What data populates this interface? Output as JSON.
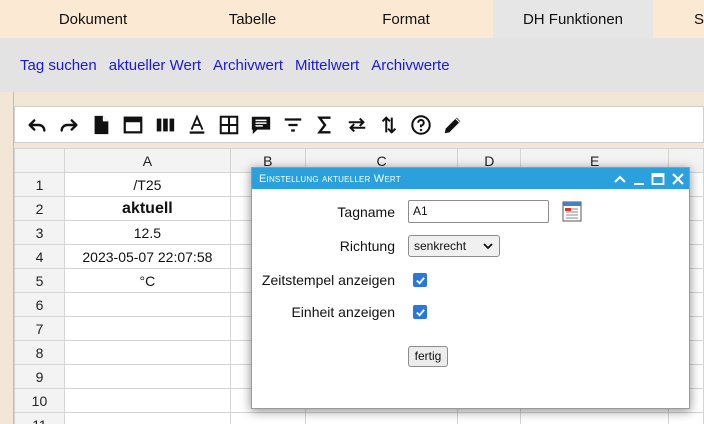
{
  "tabs": [
    {
      "label": "Dokument",
      "active": false
    },
    {
      "label": "Tabelle",
      "active": false
    },
    {
      "label": "Format",
      "active": false
    },
    {
      "label": "DH Funktionen",
      "active": true
    },
    {
      "label": "S",
      "active": false
    }
  ],
  "links": [
    "Tag suchen",
    "aktueller Wert",
    "Archivwert",
    "Mittelwert",
    "Archivwerte"
  ],
  "toolbar_icons": [
    "undo-icon",
    "redo-icon",
    "document-icon",
    "window-icon",
    "columns-icon",
    "text-color-icon",
    "borders-icon",
    "comment-icon",
    "filter-icon",
    "sum-icon",
    "swap-horizontal-icon",
    "sort-vertical-icon",
    "help-icon",
    "edit-pencil-icon"
  ],
  "sheet": {
    "columns": [
      "A",
      "B",
      "C",
      "D",
      "E"
    ],
    "rows": [
      {
        "n": "1",
        "a": "/T25"
      },
      {
        "n": "2",
        "a": "aktuell"
      },
      {
        "n": "3",
        "a": "12.5"
      },
      {
        "n": "4",
        "a": "2023-05-07 22:07:58"
      },
      {
        "n": "5",
        "a": "°C"
      },
      {
        "n": "6",
        "a": ""
      },
      {
        "n": "7",
        "a": ""
      },
      {
        "n": "8",
        "a": ""
      },
      {
        "n": "9",
        "a": ""
      },
      {
        "n": "10",
        "a": ""
      },
      {
        "n": "11",
        "a": ""
      }
    ]
  },
  "dialog": {
    "title": "Einstellung aktueller Wert",
    "tagname_label": "Tagname",
    "tagname_value": "A1",
    "richtung_label": "Richtung",
    "richtung_value": "senkrecht",
    "timestamp_label": "Zeitstempel anzeigen",
    "timestamp_checked": true,
    "unit_label": "Einheit anzeigen",
    "unit_checked": true,
    "done_button": "fertig"
  },
  "colors": {
    "tab_bar": "#fbe9d3",
    "active_tab": "#e6e6e6",
    "link": "#1a1ad8",
    "dialog_title": "#2aa0dc",
    "checkbox": "#2b78d8"
  }
}
